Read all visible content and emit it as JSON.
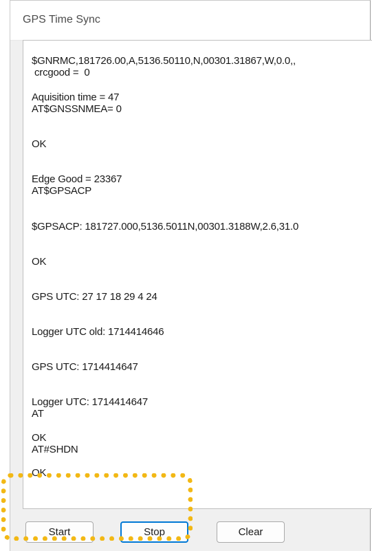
{
  "window": {
    "title": "GPS Time Sync"
  },
  "log": {
    "lines": [
      "$GNRMC,181726.00,A,5136.50110,N,00301.31867,W,0.0,,",
      " crcgood =  0",
      "Aquisition time = 47",
      "AT$GNSSNMEA= 0",
      "OK",
      "Edge Good = 23367",
      "AT$GPSACP",
      "$GPSACP: 181727.000,5136.5011N,00301.3188W,2.6,31.0",
      "OK",
      "GPS UTC: 27 17 18 29 4 24",
      "Logger UTC old: 1714414646",
      "GPS UTC: 1714414647",
      "Logger UTC: 1714414647",
      "AT",
      "OK",
      "AT#SHDN",
      "OK"
    ]
  },
  "buttons": {
    "start_label": "Start",
    "stop_label": "Stop",
    "clear_label": "Clear"
  },
  "colors": {
    "highlight": "#f2b815",
    "focus_border": "#0078d4"
  }
}
